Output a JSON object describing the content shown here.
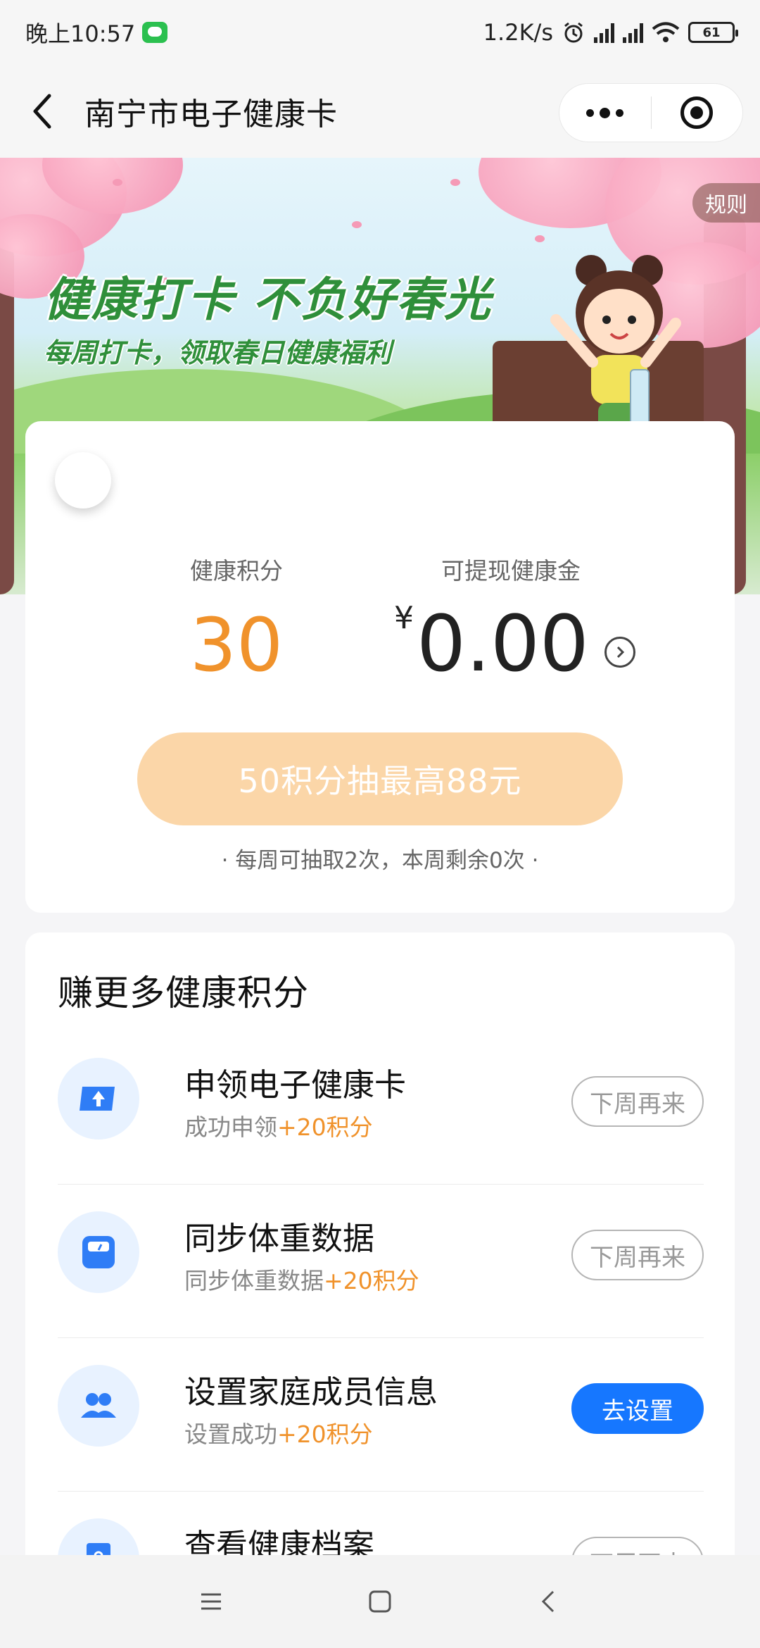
{
  "status_bar": {
    "time": "晚上10:57",
    "network_speed": "1.2K/s",
    "battery": "61"
  },
  "header": {
    "title": "南宁市电子健康卡"
  },
  "banner": {
    "title": "健康打卡 不负好春光",
    "subtitle": "每周打卡，领取春日健康福利",
    "rules_label": "规则"
  },
  "points_card": {
    "points_label": "健康积分",
    "points_value": "30",
    "cash_label": "可提现健康金",
    "currency_symbol": "¥",
    "cash_value": "0.00",
    "draw_button_label": "50积分抽最高88元",
    "draw_note": "· 每周可抽取2次，本周剩余0次 ·"
  },
  "tasks": {
    "title": "赚更多健康积分",
    "items": [
      {
        "name": "申领电子健康卡",
        "desc": "成功申领",
        "bonus": "+20积分",
        "button": "下周再来",
        "icon": "health-card-icon",
        "active": false
      },
      {
        "name": "同步体重数据",
        "desc": "同步体重数据",
        "bonus": "+20积分",
        "button": "下周再来",
        "icon": "scale-icon",
        "active": false
      },
      {
        "name": "设置家庭成员信息",
        "desc": "设置成功",
        "bonus": "+20积分",
        "button": "去设置",
        "icon": "family-icon",
        "active": true
      },
      {
        "name": "查看健康档案",
        "desc": "",
        "bonus": "",
        "button": "下周再来",
        "icon": "health-record-icon",
        "active": false
      }
    ]
  },
  "colors": {
    "accent_orange": "#f0922b",
    "primary_blue": "#1677ff",
    "draw_button_bg": "#fbd6a8"
  }
}
